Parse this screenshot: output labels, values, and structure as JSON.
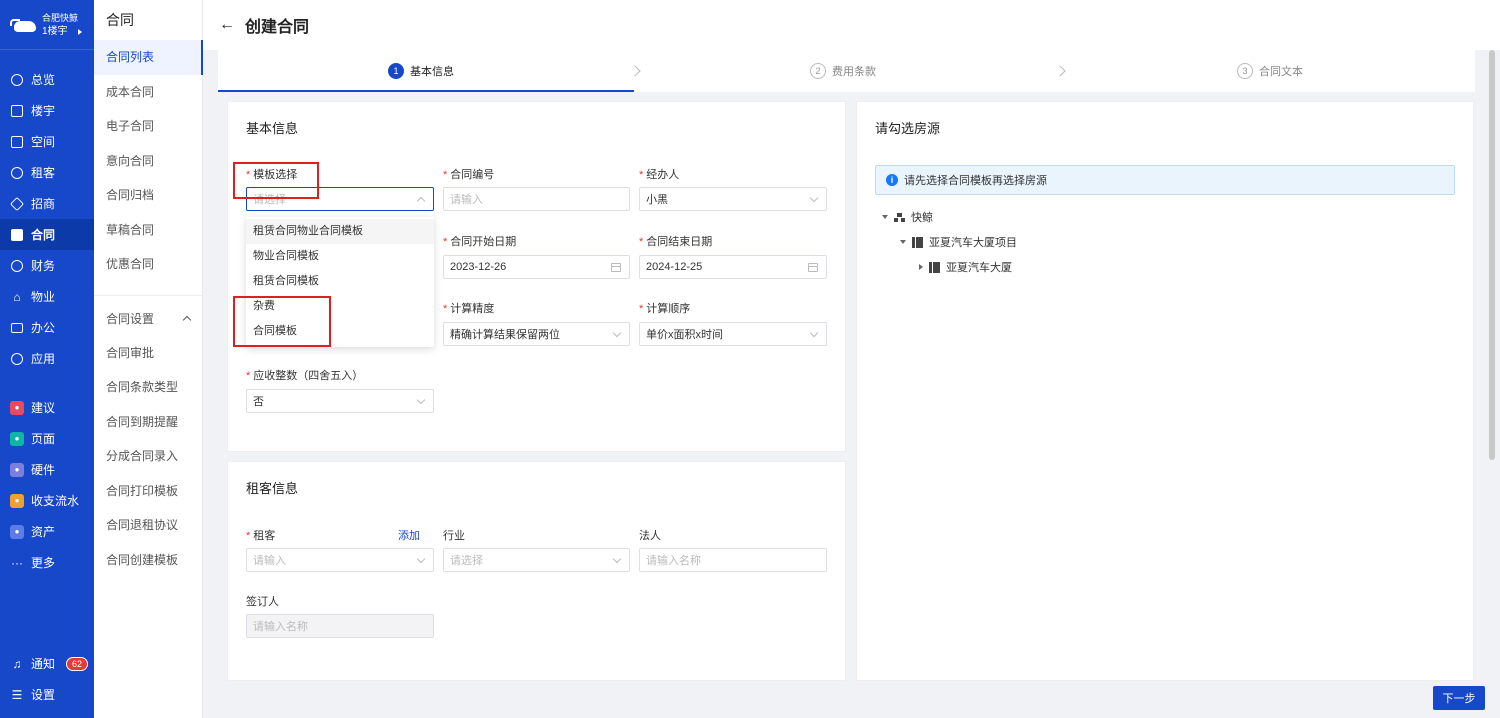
{
  "app": {
    "brand_name": "合肥快鲸",
    "building": "1楼宇"
  },
  "nav": {
    "items": [
      {
        "label": "总览",
        "icon": "dashboard-icon"
      },
      {
        "label": "楼宇",
        "icon": "building-icon"
      },
      {
        "label": "空间",
        "icon": "cube-icon"
      },
      {
        "label": "租客",
        "icon": "users-icon"
      },
      {
        "label": "招商",
        "icon": "tag-icon"
      },
      {
        "label": "合同",
        "icon": "contract-icon",
        "active": true
      },
      {
        "label": "财务",
        "icon": "finance-icon"
      },
      {
        "label": "物业",
        "icon": "home-icon"
      },
      {
        "label": "办公",
        "icon": "monitor-icon"
      },
      {
        "label": "应用",
        "icon": "apps-icon"
      }
    ],
    "apps": [
      {
        "label": "建议",
        "color": "#e84a5f"
      },
      {
        "label": "页面",
        "color": "#10b5a5"
      },
      {
        "label": "硬件",
        "color": "#7b7fe0"
      },
      {
        "label": "收支流水",
        "color": "#f0a030"
      },
      {
        "label": "资产",
        "color": "#5c7ce6"
      }
    ],
    "more": "更多",
    "notify": "通知",
    "notify_count": "62",
    "settings": "设置"
  },
  "subnav": {
    "title": "合同",
    "items": [
      "合同列表",
      "成本合同",
      "电子合同",
      "意向合同",
      "合同归档",
      "草稿合同",
      "优惠合同"
    ],
    "group": "合同设置",
    "group_items": [
      "合同审批",
      "合同条款类型",
      "合同到期提醒",
      "分成合同录入",
      "合同打印模板",
      "合同退租协议",
      "合同创建模板"
    ]
  },
  "header": {
    "back": "←",
    "title": "创建合同"
  },
  "steps": [
    {
      "num": "1",
      "label": "基本信息"
    },
    {
      "num": "2",
      "label": "费用条款"
    },
    {
      "num": "3",
      "label": "合同文本"
    }
  ],
  "basic": {
    "title": "基本信息",
    "template": {
      "label": "模板选择",
      "placeholder": "请选择"
    },
    "contract_no": {
      "label": "合同编号",
      "placeholder": "请输入"
    },
    "handler": {
      "label": "经办人",
      "value": "小黑"
    },
    "start_date": {
      "label": "合同开始日期",
      "value": "2023-12-26"
    },
    "end_date": {
      "label": "合同结束日期",
      "value": "2024-12-25"
    },
    "precision": {
      "label": "计算精度",
      "value": "精确计算结果保留两位"
    },
    "order": {
      "label": "计算顺序",
      "value": "单价x面积x时间"
    },
    "rounding": {
      "label": "应收整数（四舍五入）",
      "value": "否"
    }
  },
  "dropdown": [
    "租赁合同物业合同模板",
    "物业合同模板",
    "租赁合同模板",
    "杂费",
    "合同模板"
  ],
  "tenant": {
    "title": "租客信息",
    "tenant": {
      "label": "租客",
      "add": "添加",
      "placeholder": "请输入"
    },
    "industry": {
      "label": "行业",
      "placeholder": "请选择"
    },
    "legal": {
      "label": "法人",
      "placeholder": "请输入名称"
    },
    "signer": {
      "label": "签订人",
      "placeholder": "请输入名称"
    }
  },
  "house": {
    "title": "请勾选房源",
    "alert": "请先选择合同模板再选择房源",
    "tree": [
      "快鲸",
      "亚夏汽车大厦项目",
      "亚夏汽车大厦"
    ]
  },
  "next_label": "下一步"
}
